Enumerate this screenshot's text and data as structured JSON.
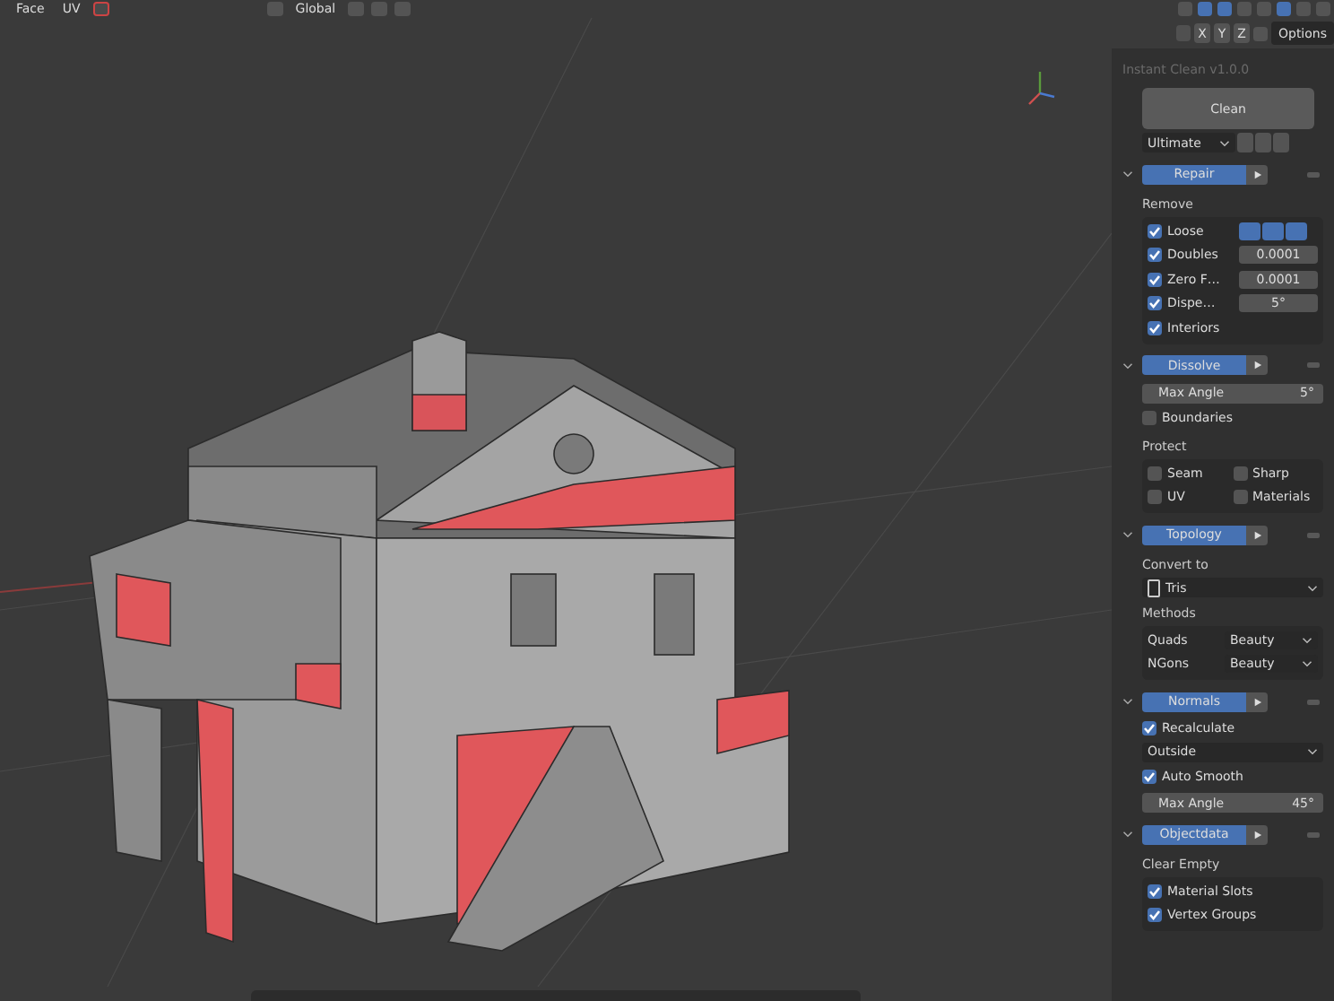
{
  "header": {
    "mode_items": [
      "Face",
      "UV"
    ],
    "orientation": "Global",
    "axes": [
      "X",
      "Y",
      "Z"
    ],
    "options_button": "Options"
  },
  "panel": {
    "title": "Instant Clean v1.0.0",
    "clean_button": "Clean",
    "preset": "Ultimate",
    "sections": [
      {
        "label": "Repair",
        "expanded": true,
        "items": [
          {
            "kind": "label",
            "text": "Remove"
          },
          {
            "kind": "check_group",
            "rows": [
              {
                "label": "Loose",
                "checked": true,
                "toggles": [
                  {
                    "on": true
                  },
                  {
                    "on": true
                  },
                  {
                    "on": true
                  }
                ]
              },
              {
                "label": "Doubles",
                "checked": true,
                "value": "0.0001"
              },
              {
                "label": "Zero F…",
                "checked": true,
                "value": "0.0001"
              },
              {
                "label": "Dispe…",
                "checked": true,
                "value": "5°"
              },
              {
                "label": "Interiors",
                "checked": true
              }
            ]
          }
        ]
      },
      {
        "label": "Dissolve",
        "expanded": true,
        "items": [
          {
            "kind": "field",
            "label": "Max Angle",
            "value": "5°"
          },
          {
            "kind": "check",
            "label": "Boundaries",
            "checked": false
          },
          {
            "kind": "label",
            "text": "Protect"
          },
          {
            "kind": "check_grid",
            "rows": [
              {
                "label": "Seam",
                "checked": false
              },
              {
                "label": "Sharp",
                "checked": false
              },
              {
                "label": "UV",
                "checked": false
              },
              {
                "label": "Materials",
                "checked": false
              }
            ]
          }
        ]
      },
      {
        "label": "Topology",
        "expanded": true,
        "items": [
          {
            "kind": "label",
            "text": "Convert to"
          },
          {
            "kind": "dropdown",
            "value": "Tris",
            "icon": true
          },
          {
            "kind": "label",
            "text": "Methods"
          },
          {
            "kind": "dropdown_group",
            "rows": [
              {
                "label": "Quads",
                "value": "Beauty"
              },
              {
                "label": "NGons",
                "value": "Beauty"
              }
            ]
          }
        ]
      },
      {
        "label": "Normals",
        "expanded": true,
        "items": [
          {
            "kind": "check",
            "label": "Recalculate",
            "checked": true
          },
          {
            "kind": "dropdown",
            "value": "Outside",
            "icon": false
          },
          {
            "kind": "check",
            "label": "Auto Smooth",
            "checked": true
          },
          {
            "kind": "field",
            "label": "Max Angle",
            "value": "45°"
          }
        ]
      },
      {
        "label": "Objectdata",
        "expanded": true,
        "items": [
          {
            "kind": "label",
            "text": "Clear Empty"
          },
          {
            "kind": "check_group",
            "rows": [
              {
                "label": "Material Slots",
                "checked": true
              },
              {
                "label": "Vertex Groups",
                "checked": true
              }
            ]
          }
        ]
      }
    ]
  }
}
